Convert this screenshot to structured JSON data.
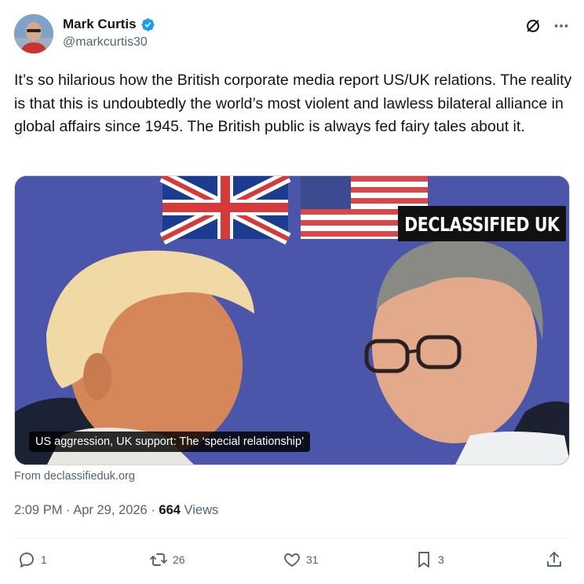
{
  "author": {
    "name": "Mark Curtis",
    "handle": "@markcurtis30",
    "verified": true,
    "verified_color": "#1d9bf0"
  },
  "header_icons": [
    "grok-icon",
    "more-icon"
  ],
  "tweet": {
    "text": "It’s so hilarious how the British corporate media report US/UK relations. The reality is that this is undoubtedly the world’s most violent and lawless bilateral alliance in global affairs since 1945. The British public is always fed fairy tales about it."
  },
  "media": {
    "brand_text": "DECLASSIFIED UK",
    "caption": "US aggression, UK support: The ‘special relationship’",
    "source": "From declassifieduk.org"
  },
  "meta": {
    "time": "2:09 PM",
    "separator": "·",
    "date": "Apr 29, 2026",
    "views_count": "664",
    "views_label": "Views"
  },
  "actions": {
    "replies": "1",
    "reposts": "26",
    "likes": "31",
    "bookmarks": "3"
  },
  "colors": {
    "text": "#0f1419",
    "secondary": "#536471",
    "accent": "#1d9bf0",
    "media_bg": "#4a54a8"
  }
}
